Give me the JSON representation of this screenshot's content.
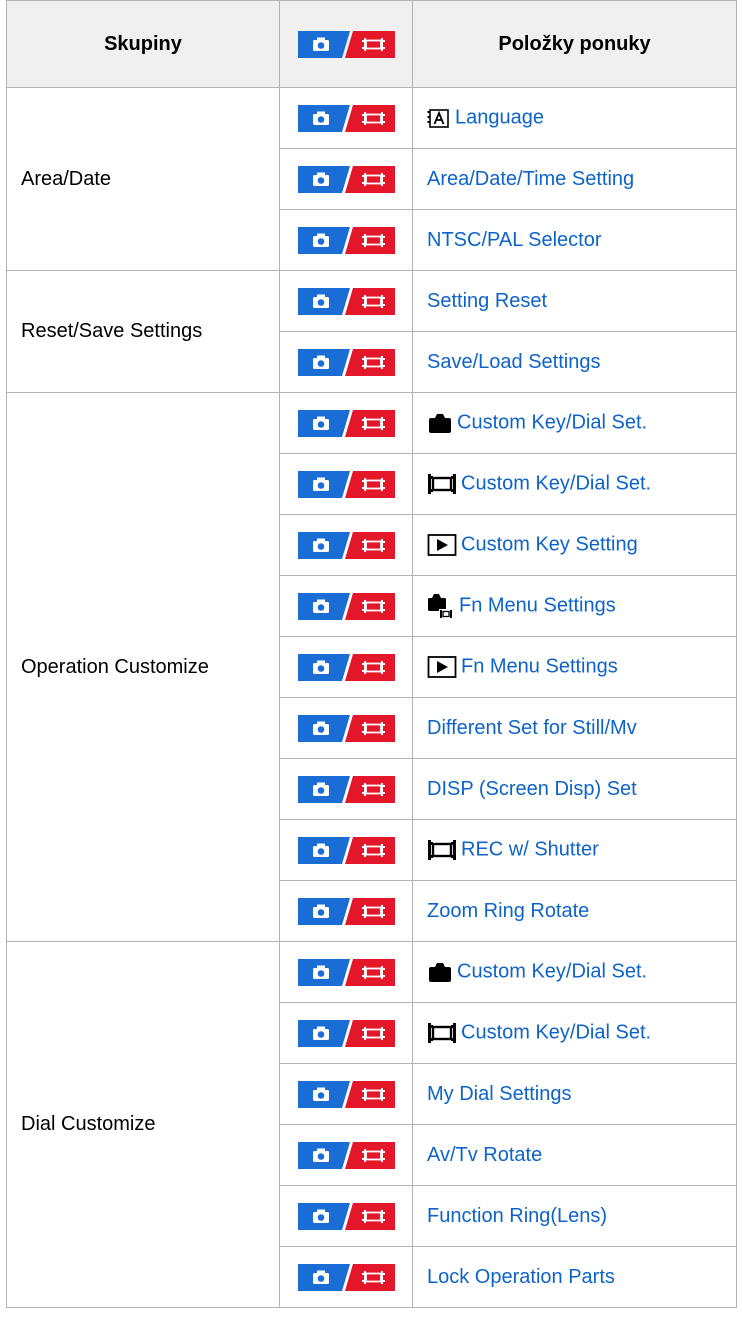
{
  "table": {
    "header": {
      "group": "Skupiny",
      "mode_icons": "still-movie-mode-icon",
      "items": "Položky ponuky"
    },
    "colors": {
      "still_badge": "#1a6dd5",
      "movie_badge": "#e4162a",
      "link": "#0e63c9"
    },
    "groups": [
      {
        "name": "Area/Date",
        "items": [
          {
            "icon": "language-icon",
            "label": "Language"
          },
          {
            "icon": "",
            "label": "Area/Date/Time Setting"
          },
          {
            "icon": "",
            "label": "NTSC/PAL Selector"
          }
        ]
      },
      {
        "name": "Reset/Save Settings",
        "items": [
          {
            "icon": "",
            "label": "Setting Reset"
          },
          {
            "icon": "",
            "label": "Save/Load Settings"
          }
        ]
      },
      {
        "name": "Operation Customize",
        "items": [
          {
            "icon": "camera-icon",
            "label": "Custom Key/Dial Set."
          },
          {
            "icon": "movie-icon",
            "label": "Custom Key/Dial Set."
          },
          {
            "icon": "playback-icon",
            "label": "Custom Key Setting"
          },
          {
            "icon": "camera-movie-icon",
            "label": "Fn Menu Settings"
          },
          {
            "icon": "playback-icon",
            "label": "Fn Menu Settings"
          },
          {
            "icon": "",
            "label": "Different Set for Still/Mv"
          },
          {
            "icon": "",
            "label": "DISP (Screen Disp) Set"
          },
          {
            "icon": "movie-icon",
            "label": "REC w/ Shutter"
          },
          {
            "icon": "",
            "label": "Zoom Ring Rotate"
          }
        ]
      },
      {
        "name": "Dial Customize",
        "items": [
          {
            "icon": "camera-icon",
            "label": "Custom Key/Dial Set."
          },
          {
            "icon": "movie-icon",
            "label": "Custom Key/Dial Set."
          },
          {
            "icon": "",
            "label": "My Dial Settings"
          },
          {
            "icon": "",
            "label": "Av/Tv Rotate"
          },
          {
            "icon": "",
            "label": "Function Ring(Lens)"
          },
          {
            "icon": "",
            "label": "Lock Operation Parts"
          }
        ]
      }
    ]
  }
}
